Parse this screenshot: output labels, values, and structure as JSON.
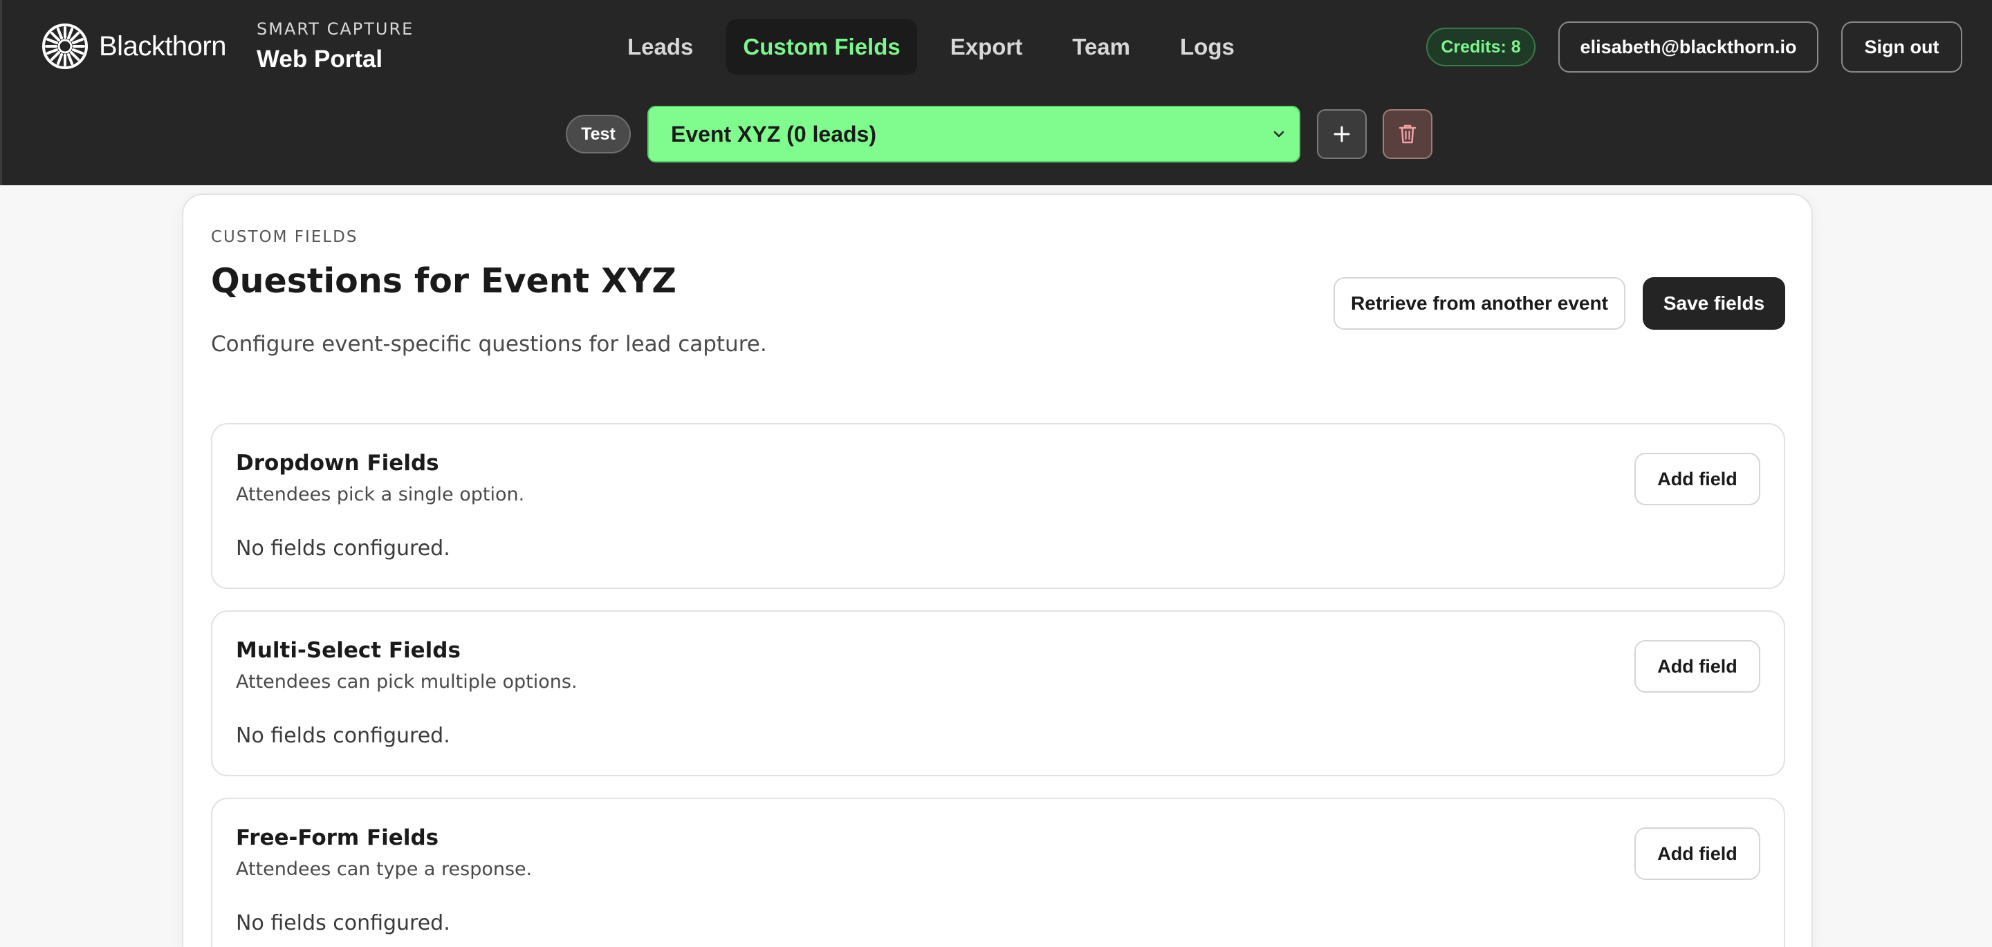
{
  "colors": {
    "header_bg": "#262626",
    "accent_green": "#7ef58f",
    "select_bg": "#80fb8e",
    "primary_button": "#242424"
  },
  "brand": {
    "name": "Blackthorn",
    "logo_icon": "sunburst-logo-icon"
  },
  "portal": {
    "kicker": "SMART CAPTURE",
    "title": "Web Portal"
  },
  "nav": {
    "items": [
      {
        "label": "Leads",
        "active": false
      },
      {
        "label": "Custom Fields",
        "active": true
      },
      {
        "label": "Export",
        "active": false
      },
      {
        "label": "Team",
        "active": false
      },
      {
        "label": "Logs",
        "active": false
      }
    ]
  },
  "account": {
    "credits": "Credits: 8",
    "email": "elisabeth@blackthorn.io",
    "sign_out": "Sign out"
  },
  "event_bar": {
    "env_badge": "Test",
    "selected_event": "Event XYZ (0 leads)",
    "add_icon": "plus-icon",
    "delete_icon": "trash-icon"
  },
  "main": {
    "kicker": "CUSTOM FIELDS",
    "title": "Questions for Event XYZ",
    "description": "Configure event-specific questions for lead capture.",
    "retrieve_label": "Retrieve from another event",
    "save_label": "Save fields"
  },
  "sections": [
    {
      "title": "Dropdown Fields",
      "subtitle": "Attendees pick a single option.",
      "empty_text": "No fields configured.",
      "add_label": "Add field"
    },
    {
      "title": "Multi-Select Fields",
      "subtitle": "Attendees can pick multiple options.",
      "empty_text": "No fields configured.",
      "add_label": "Add field"
    },
    {
      "title": "Free-Form Fields",
      "subtitle": "Attendees can type a response.",
      "empty_text": "No fields configured.",
      "add_label": "Add field"
    }
  ]
}
